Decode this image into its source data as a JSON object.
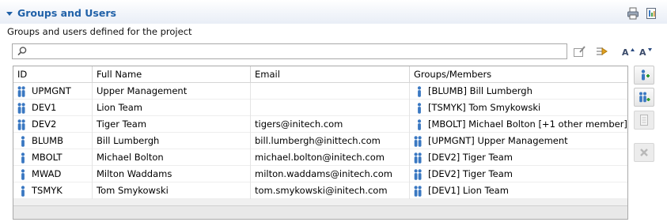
{
  "section": {
    "title": "Groups and Users",
    "description": "Groups and users defined for the project"
  },
  "search": {
    "value": "",
    "placeholder": ""
  },
  "table": {
    "columns": [
      "ID",
      "Full Name",
      "Email",
      "Groups/Members"
    ],
    "rows": [
      {
        "type": "group",
        "id": "UPMGNT",
        "full_name": "Upper Management",
        "email": "",
        "member_type": "user",
        "members": "[BLUMB] Bill Lumbergh"
      },
      {
        "type": "group",
        "id": "DEV1",
        "full_name": "Lion Team",
        "email": "",
        "member_type": "user",
        "members": "[TSMYK] Tom Smykowski"
      },
      {
        "type": "group",
        "id": "DEV2",
        "full_name": "Tiger Team",
        "email": "tigers@initech.com",
        "member_type": "user",
        "members": "[MBOLT] Michael Bolton [+1 other member]"
      },
      {
        "type": "user",
        "id": "BLUMB",
        "full_name": "Bill Lumbergh",
        "email": "bill.lumbergh@inittech.com",
        "member_type": "group",
        "members": "[UPMGNT] Upper Management"
      },
      {
        "type": "user",
        "id": "MBOLT",
        "full_name": "Michael Bolton",
        "email": "michael.bolton@initech.com",
        "member_type": "group",
        "members": "[DEV2] Tiger Team"
      },
      {
        "type": "user",
        "id": "MWAD",
        "full_name": "Milton Waddams",
        "email": "milton.waddams@initech.com",
        "member_type": "group",
        "members": "[DEV2] Tiger Team"
      },
      {
        "type": "user",
        "id": "TSMYK",
        "full_name": "Tom Smykowski",
        "email": "tom.smykowski@initech.com",
        "member_type": "group",
        "members": "[DEV1] Lion Team"
      }
    ]
  },
  "colors": {
    "accent": "#2061a8",
    "person_blue": "#3a78c2"
  },
  "icons": {
    "header": [
      "print-icon",
      "export-report-icon"
    ],
    "toolbar": [
      "edit-selection-icon",
      "redirect-arrow-icon",
      "sort-ascending-icon",
      "sort-descending-icon"
    ],
    "side_buttons": [
      "add-user-icon",
      "add-group-icon",
      "properties-icon",
      "delete-icon"
    ]
  }
}
